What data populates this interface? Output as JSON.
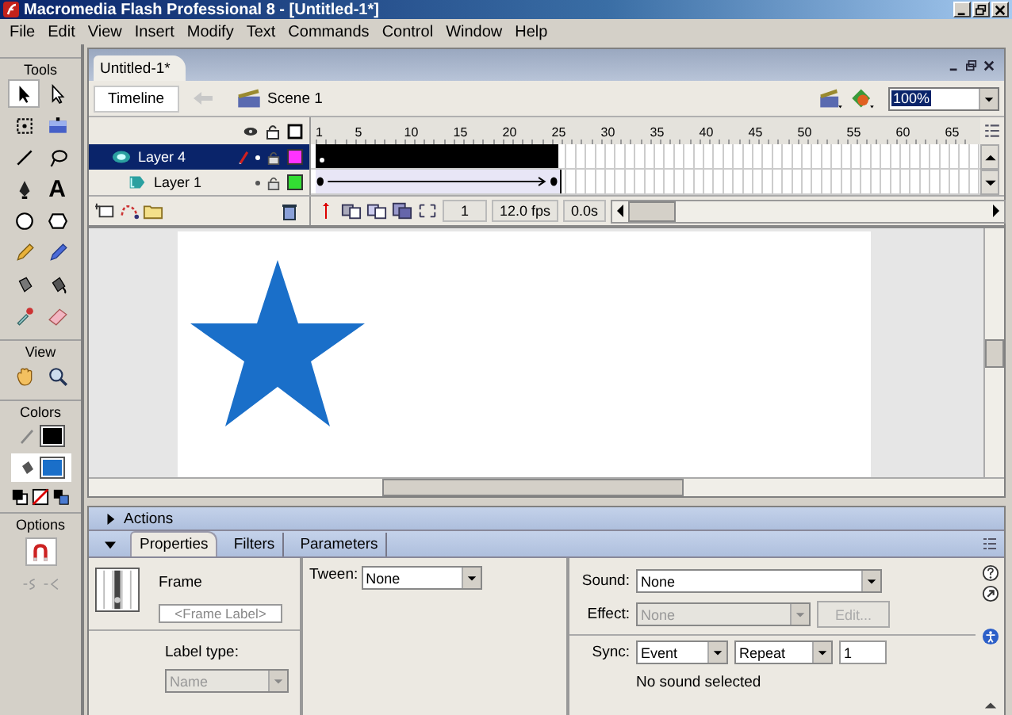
{
  "window": {
    "title": "Macromedia Flash Professional 8 - [Untitled-1*]"
  },
  "menu": [
    "File",
    "Edit",
    "View",
    "Insert",
    "Modify",
    "Text",
    "Commands",
    "Control",
    "Window",
    "Help"
  ],
  "tools": {
    "sections": [
      "Tools",
      "View",
      "Colors",
      "Options"
    ],
    "text_tool_glyph": "A"
  },
  "document": {
    "tab": "Untitled-1*",
    "timeline_button": "Timeline",
    "scene": "Scene 1",
    "zoom": "100%"
  },
  "timeline": {
    "ruler": [
      "1",
      "5",
      "10",
      "15",
      "20",
      "25",
      "30",
      "35",
      "40",
      "45",
      "50",
      "55",
      "60",
      "65"
    ],
    "layers": [
      {
        "name": "Layer 4",
        "selected": true,
        "editing": true,
        "color": "#ff33ff",
        "kind": "guide"
      },
      {
        "name": "Layer 1",
        "selected": false,
        "editing": false,
        "color": "#33dd33",
        "kind": "guided"
      }
    ],
    "frame": "1",
    "fps": "12.0 fps",
    "time": "0.0s"
  },
  "panels": {
    "actions": {
      "title": "Actions",
      "expanded": false
    },
    "tabs": [
      {
        "label": "Properties",
        "selected": true
      },
      {
        "label": "Filters",
        "selected": false
      },
      {
        "label": "Parameters",
        "selected": false
      }
    ],
    "properties": {
      "heading": "Frame",
      "label_placeholder": "<Frame Label>",
      "label_type": "Label type:",
      "label_type_value": "Name",
      "tween_label": "Tween:",
      "tween": "None",
      "sound_label": "Sound:",
      "sound": "None",
      "effect_label": "Effect:",
      "effect": "None",
      "effect_disabled": true,
      "edit_button": "Edit...",
      "sync_label": "Sync:",
      "sync": "Event",
      "repeat": "Repeat",
      "repeat_count": "1",
      "status": "No sound selected"
    }
  }
}
